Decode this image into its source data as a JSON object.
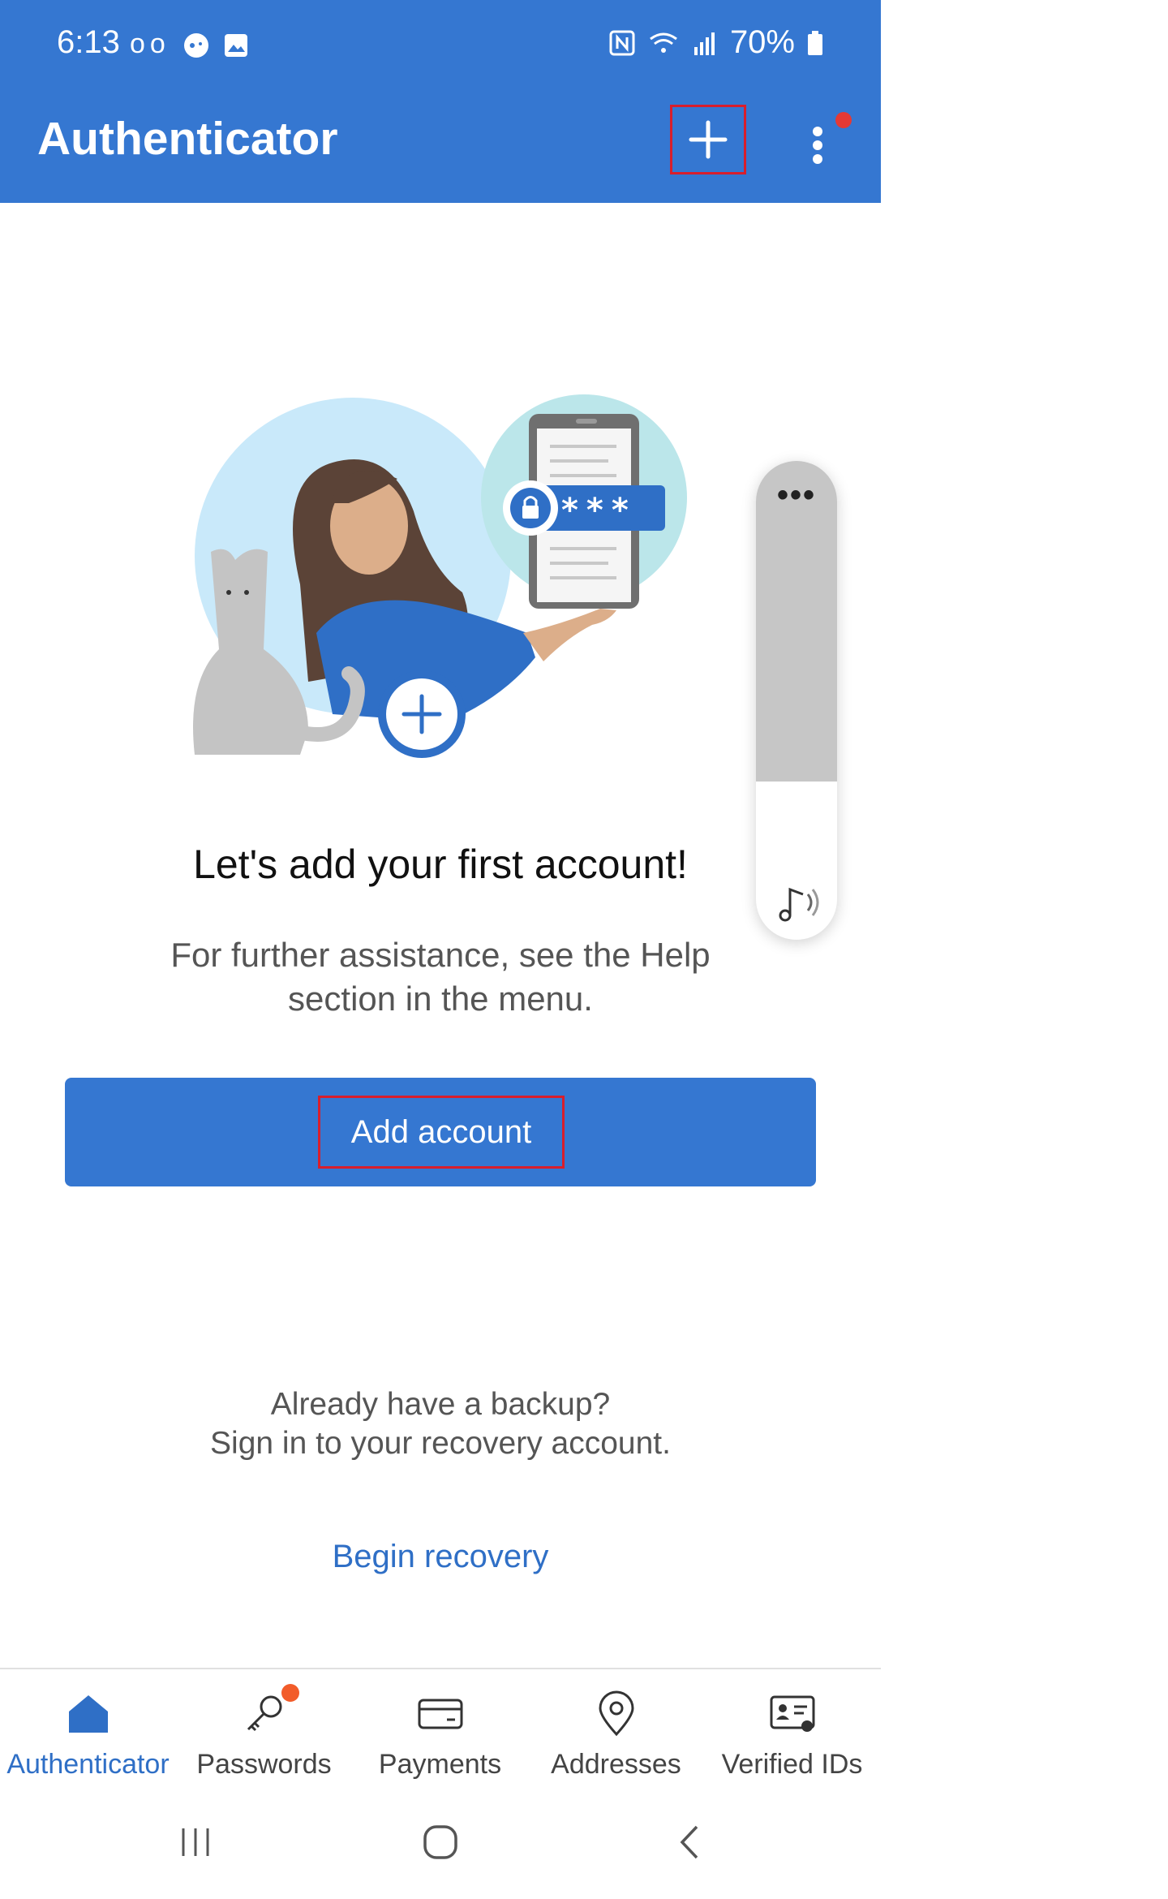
{
  "status_bar": {
    "time": "6:13",
    "left_icons": [
      "voicemail-icon",
      "game-icon",
      "gallery-icon"
    ],
    "right_icons": [
      "nfc-icon",
      "wifi-icon",
      "signal-icon"
    ],
    "battery": "70%"
  },
  "app_bar": {
    "title": "Authenticator",
    "add_icon": "plus-icon",
    "menu_icon": "more-vertical-icon"
  },
  "empty_state": {
    "heading": "Let's add your first account!",
    "subtext": "For further assistance, see the Help section in the menu.",
    "password_mask": "***"
  },
  "primary_button": {
    "label": "Add account"
  },
  "backup": {
    "line1": "Already have a backup?",
    "line2": "Sign in to your recovery account."
  },
  "recovery_link": "Begin recovery",
  "volume_widget": {
    "dots": "•••",
    "level_fraction": 0.33
  },
  "bottom_nav": {
    "items": [
      {
        "label": "Authenticator",
        "icon": "home-icon",
        "active": true
      },
      {
        "label": "Passwords",
        "icon": "key-icon",
        "badge": true
      },
      {
        "label": "Payments",
        "icon": "card-icon"
      },
      {
        "label": "Addresses",
        "icon": "location-pin-icon"
      },
      {
        "label": "Verified IDs",
        "icon": "id-card-icon"
      }
    ]
  },
  "colors": {
    "brand": "#3577d1",
    "link": "#2f6fc6",
    "highlight_border": "#d81e2c",
    "badge": "#f25c2a"
  }
}
